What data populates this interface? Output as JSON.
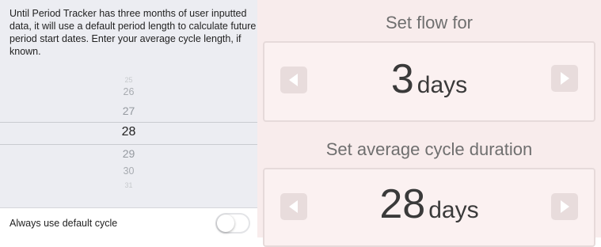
{
  "settings": {
    "intro_text": "Until Period Tracker has three months of user inputted data, it will use a default period length to calculate future period start dates. Enter your average cycle length, if known.",
    "picker": {
      "values": [
        "25",
        "26",
        "27",
        "28",
        "29",
        "30",
        "31"
      ],
      "selected": "28"
    },
    "toggle": {
      "label": "Always use default cycle",
      "state": "off"
    }
  },
  "flow": {
    "heading": "Set flow for",
    "value": "3",
    "unit": "days"
  },
  "cycle": {
    "heading": "Set average cycle duration",
    "value": "28",
    "unit": "days"
  },
  "icons": {
    "decrement": "left-arrow-icon",
    "increment": "right-arrow-icon"
  },
  "colors": {
    "left_background": "#ecedf2",
    "right_background": "#f8ecec",
    "arrow_button": "#e8dcdc"
  }
}
